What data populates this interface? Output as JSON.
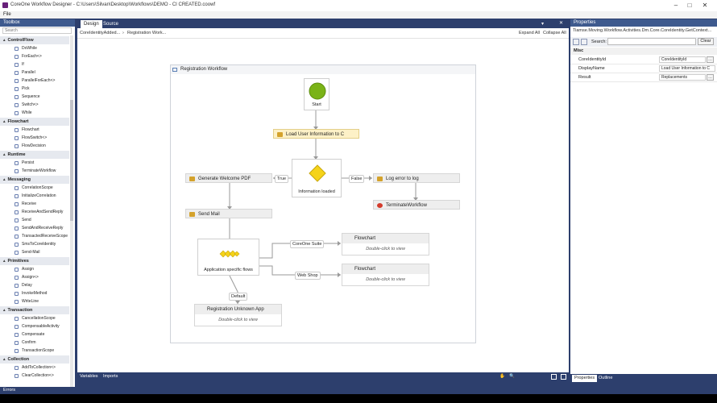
{
  "window": {
    "title": "CoreOne Workflow Designer - C:\\Users\\Silvan\\Desktop\\Workflows\\DEMO - CI CREATED.coowf",
    "controls": [
      "–",
      "□",
      "✕"
    ]
  },
  "menu": {
    "file": "File"
  },
  "toolbox": {
    "title": "Toolbox",
    "search_placeholder": "Search",
    "categories": [
      {
        "name": "ControlFlow",
        "items": [
          "DoWhile",
          "ForEach<>",
          "If",
          "Parallel",
          "ParallelForEach<>",
          "Pick",
          "Sequence",
          "Switch<>",
          "While"
        ]
      },
      {
        "name": "Flowchart",
        "items": [
          "Flowchart",
          "FlowSwitch<>",
          "FlowDecision"
        ]
      },
      {
        "name": "Runtime",
        "items": [
          "Persist",
          "TerminateWorkflow"
        ]
      },
      {
        "name": "Messaging",
        "items": [
          "CorrelationScope",
          "InitializeCorrelation",
          "Receive",
          "ReceiveAndSendReply",
          "Send",
          "SendAndReceiveReply",
          "TransactedReceiveScope",
          "SmsToCoreIdentity",
          "Send-Mail"
        ]
      },
      {
        "name": "Primitives",
        "items": [
          "Assign",
          "Assign<>",
          "Delay",
          "InvokeMethod",
          "WriteLine"
        ]
      },
      {
        "name": "Transaction",
        "items": [
          "CancellationScope",
          "CompensableActivity",
          "Compensate",
          "Confirm",
          "TransactionScope"
        ]
      },
      {
        "name": "Collection",
        "items": [
          "AddToCollection<>",
          "ClearCollection<>"
        ]
      }
    ]
  },
  "designer": {
    "tabs": [
      "Design",
      "Source"
    ],
    "breadcrumb": [
      "CoreIdentityAdded...",
      "Registration Work..."
    ],
    "breadcrumb_sep": "›",
    "expand_all": "Expand All",
    "collapse_all": "Collapse All",
    "workflow_title": "Registration Workflow",
    "start_label": "Start",
    "load_user": "Load User Information to C",
    "decision_label": "Information loaded",
    "true_label": "True",
    "false_label": "False",
    "generate_pdf": "Generate Welcome PDF",
    "log_error": "Log error to log",
    "terminate": "TerminateWorkflow",
    "send_mail": "Send Mail",
    "switch_label": "Application specific flows",
    "coreone_suite": "CoreOne Suite",
    "web_shop": "Web Shop",
    "default_label": "Default",
    "flowchart1_title": "Flowchart",
    "flowchart1_body": "Double-click to view",
    "flowchart2_title": "Flowchart",
    "flowchart2_body": "Double-click to view",
    "unknown_title": "Registration Unknown App",
    "unknown_body": "Double-click to view",
    "bottom_tabs": [
      "Variables",
      "Imports"
    ]
  },
  "properties": {
    "title": "Properties",
    "type_text": "Tiamse.Moving.Workflow.Activities.Dm.Core.CoreIdentity.GetContext...",
    "search_label": "Search:",
    "clear_label": "Clear",
    "section": "Misc",
    "rows": [
      {
        "name": "CoreIdentityId",
        "value": "CoreIdentityId"
      },
      {
        "name": "DisplayName",
        "value": "Load User Information to C"
      },
      {
        "name": "Result",
        "value": "Replacements"
      }
    ],
    "tabs": [
      "Properties",
      "Outline"
    ]
  },
  "errors": {
    "label": "Errors"
  },
  "colors": {
    "chrome": "#2d3f6d",
    "start": "#7ab317",
    "decision": "#f5d31a",
    "terminate": "#d33b2c"
  }
}
